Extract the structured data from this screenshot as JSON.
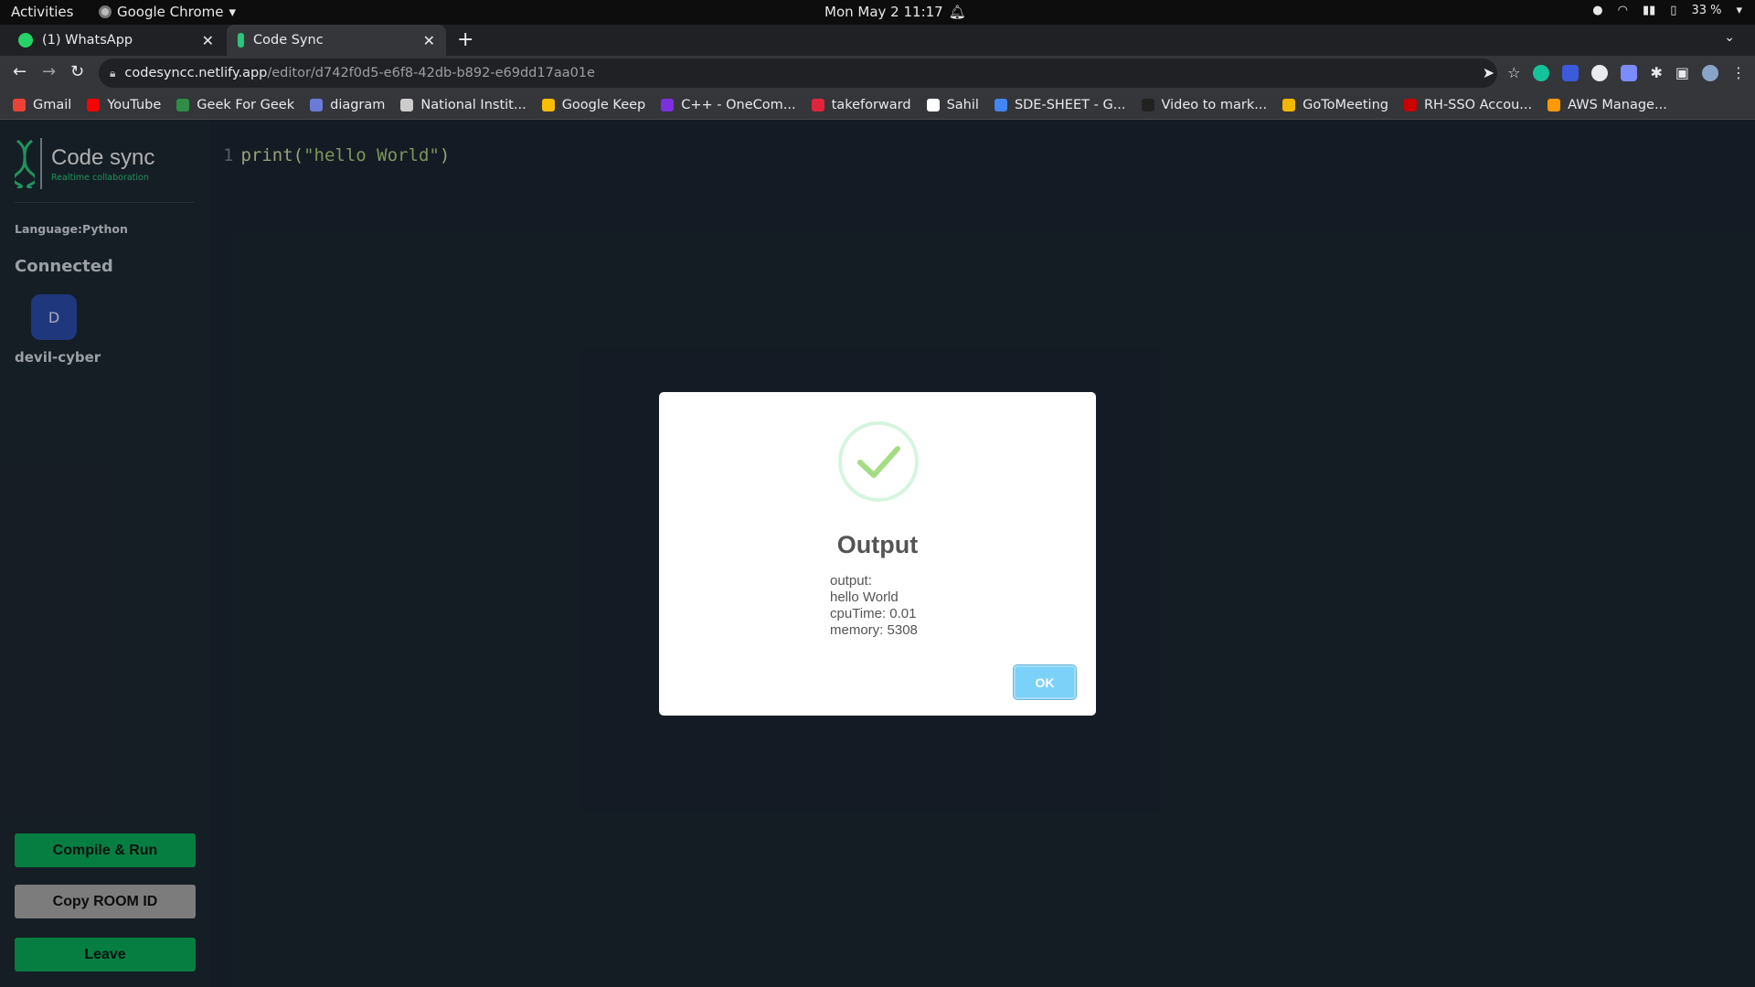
{
  "topbar": {
    "activities": "Activities",
    "app_name": "Google Chrome",
    "clock": "Mon May 2  11:17",
    "battery": "33 %"
  },
  "tabs": [
    {
      "label": "(1) WhatsApp",
      "favicon_color": "#25d366"
    },
    {
      "label": "Code Sync",
      "favicon_color": "#2cc37a"
    }
  ],
  "omnibox": {
    "domain": "codesyncc.netlify.app",
    "path": "/editor/d742f0d5-e6f8-42db-b892-e69dd17aa01e"
  },
  "bookmarks": [
    {
      "label": "Gmail",
      "color": "#ea4335"
    },
    {
      "label": "YouTube",
      "color": "#ff0000"
    },
    {
      "label": "Geek For Geek",
      "color": "#2f8d46"
    },
    {
      "label": "diagram",
      "color": "#6a7bd8"
    },
    {
      "label": "National Instit...",
      "color": "#cccccc"
    },
    {
      "label": "Google Keep",
      "color": "#fbbc04"
    },
    {
      "label": "C++ - OneCom...",
      "color": "#7b2fe0"
    },
    {
      "label": "takeforward",
      "color": "#e0243b"
    },
    {
      "label": "Sahil",
      "color": "#ffffff"
    },
    {
      "label": "SDE-SHEET - G...",
      "color": "#4285f4"
    },
    {
      "label": "Video to mark...",
      "color": "#222222"
    },
    {
      "label": "GoToMeeting",
      "color": "#f2b600"
    },
    {
      "label": "RH-SSO Accou...",
      "color": "#cc0000"
    },
    {
      "label": "AWS Manage...",
      "color": "#ff9900"
    }
  ],
  "sidebar": {
    "logo_title": "Code sync",
    "logo_subtitle": "Realtime collaboration",
    "language": "Language:Python",
    "connected_heading": "Connected",
    "user_initial": "D",
    "username": "devil-cyber",
    "buttons": {
      "run": "Compile & Run",
      "copy": "Copy ROOM ID",
      "leave": "Leave"
    }
  },
  "editor": {
    "line_number": "1",
    "code": {
      "fn": "print",
      "open": "(",
      "str": "\"hello World\"",
      "close": ")"
    }
  },
  "modal": {
    "title": "Output",
    "lines": [
      "output:",
      "hello World",
      "cpuTime: 0.01",
      "memory: 5308"
    ],
    "ok_label": "OK"
  },
  "colors": {
    "accent": "#09a858",
    "sidebar_bg": "#1d2732",
    "editor_bg": "#1b2530"
  }
}
